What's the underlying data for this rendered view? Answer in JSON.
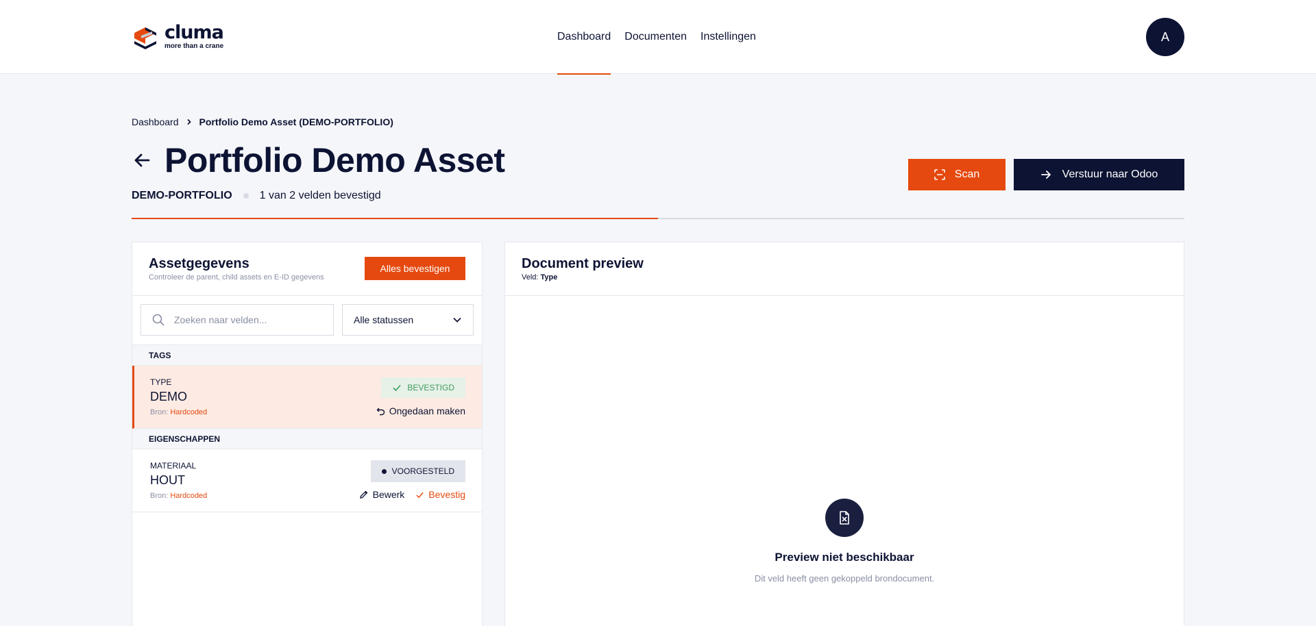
{
  "brand": {
    "name": "cluma",
    "tagline": "more than a crane",
    "accent": "#e5490f",
    "navy": "#0d1333"
  },
  "nav": {
    "items": [
      {
        "label": "Dashboard",
        "active": true
      },
      {
        "label": "Documenten",
        "active": false
      },
      {
        "label": "Instellingen",
        "active": false
      }
    ],
    "avatar_initial": "A"
  },
  "breadcrumb": {
    "root": "Dashboard",
    "current": "Portfolio Demo Asset (DEMO-PORTFOLIO)"
  },
  "page": {
    "title": "Portfolio Demo Asset",
    "code": "DEMO-PORTFOLIO",
    "progress_text": "1 van 2 velden bevestigd",
    "progress_fraction": 0.5
  },
  "toolbar": {
    "scan_label": "Scan",
    "send_label": "Verstuur naar Odoo"
  },
  "asset_panel": {
    "title": "Assetgegevens",
    "subtitle": "Controleer de parent, child assets en E-ID gegevens",
    "confirm_all_label": "Alles bevestigen",
    "search_placeholder": "Zoeken naar velden...",
    "status_filter": "Alle statussen",
    "source_prefix": "Bron:",
    "sections": [
      {
        "heading": "TAGS",
        "fields": [
          {
            "label": "TYPE",
            "value": "DEMO",
            "source": "Hardcoded",
            "status": "BEVESTIGD",
            "action": "Ongedaan maken"
          }
        ]
      },
      {
        "heading": "EIGENSCHAPPEN",
        "fields": [
          {
            "label": "MATERIAAL",
            "value": "HOUT",
            "source": "Hardcoded",
            "status": "VOORGESTELD",
            "edit_label": "Bewerk",
            "confirm_label": "Bevestig"
          }
        ]
      }
    ]
  },
  "preview_panel": {
    "title": "Document preview",
    "field_prefix": "Veld:",
    "field_name": "Type",
    "empty_title": "Preview niet beschikbaar",
    "empty_text": "Dit veld heeft geen gekoppeld brondocument."
  }
}
